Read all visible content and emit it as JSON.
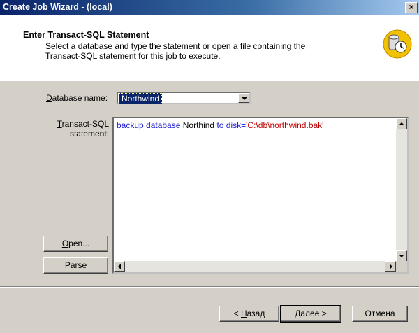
{
  "window": {
    "title": "Create Job Wizard - (local)",
    "close_glyph": "×"
  },
  "header": {
    "title": "Enter Transact-SQL Statement",
    "description": "Select a database and type the statement or open a file containing the Transact-SQL statement for this job to execute.",
    "icon": "job-clock-icon"
  },
  "form": {
    "database_label_accel": "D",
    "database_label_rest": "atabase name:",
    "database_value": "Northwind",
    "statement_label_accel": "T",
    "statement_label_rest": "ransact-SQL",
    "statement_label_line2": "statement:",
    "sql": {
      "kw1": "backup database",
      "ident": " Northind ",
      "kw2": "to disk=",
      "str": "'C:\\db\\northwind.bak'"
    }
  },
  "side_buttons": {
    "open_accel": "O",
    "open_rest": "pen...",
    "parse_accel": "P",
    "parse_rest": "arse"
  },
  "footer": {
    "back_prefix": "< ",
    "back_accel": "Н",
    "back_rest": "азад",
    "next_accel": "Д",
    "next_rest": "алее",
    "next_suffix": " >",
    "cancel": "Отмена"
  }
}
